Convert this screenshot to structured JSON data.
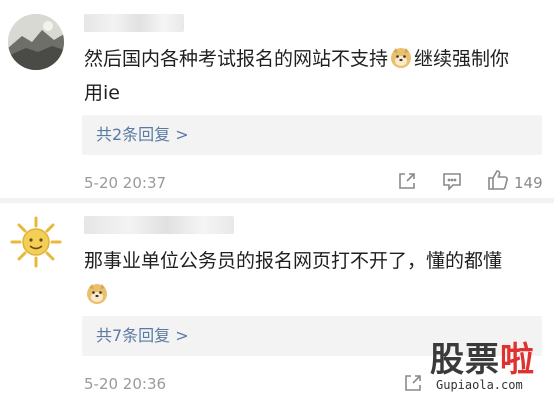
{
  "comments": [
    {
      "avatar_icon": "landscape-avatar-icon",
      "text_part1": "然后国内各种考试报名的网站不支持",
      "emoji": "doge-emoji-icon",
      "text_part2": "继续强制你",
      "text_line2": "用ie",
      "replies_label": "共2条回复 >",
      "time": "5-20 20:37",
      "likes": "149"
    },
    {
      "avatar_icon": "sun-avatar-icon",
      "text_part1": "那事业单位公务员的报名网页打不开了，懂的都懂",
      "emoji": "doge-emoji-icon",
      "replies_label": "共7条回复 >",
      "time": "5-20 20:36"
    }
  ],
  "watermark": {
    "chars_a": "股票",
    "chars_b": "啦",
    "url": "Gupiaola.com"
  },
  "colors": {
    "link": "#5a7aa3",
    "meta": "#9a9a9a",
    "reply_bg": "#f3f3f3",
    "watermark_red": "#e03030"
  }
}
